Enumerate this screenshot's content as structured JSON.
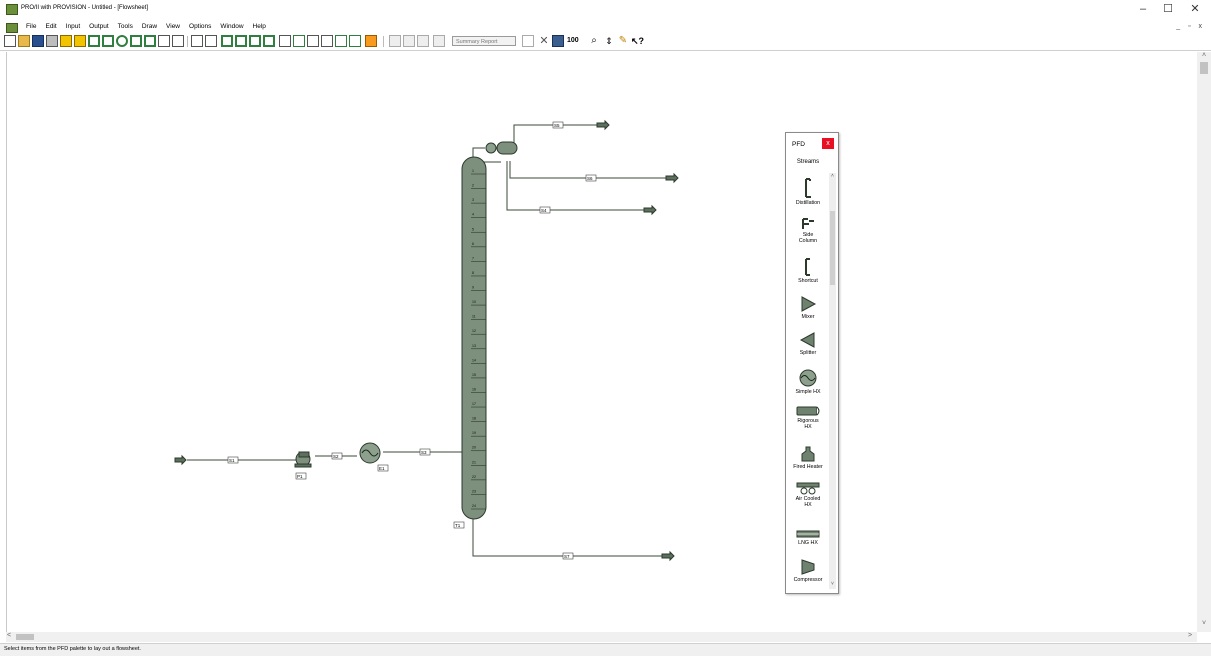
{
  "window": {
    "title": "PRO/II with PROVISION - Untitled - [Flowsheet]",
    "minimize": "–",
    "maximize": "☐",
    "close": "✕"
  },
  "menu": {
    "items": [
      "File",
      "Edit",
      "Input",
      "Output",
      "Tools",
      "Draw",
      "View",
      "Options",
      "Window",
      "Help"
    ],
    "mdi_controls": "_ ▫ x"
  },
  "toolbar": {
    "report_combo": "Summary Report",
    "zoom_label": "100"
  },
  "flowsheet": {
    "streams": [
      "S1",
      "S2",
      "S3",
      "S4",
      "S5",
      "S6",
      "S7"
    ],
    "units": [
      "P1",
      "E1",
      "T1"
    ],
    "trays": [
      "1",
      "2",
      "3",
      "4",
      "5",
      "6",
      "7",
      "8",
      "9",
      "10",
      "11",
      "12",
      "13",
      "14",
      "15",
      "16",
      "17",
      "18",
      "19",
      "20",
      "21",
      "22",
      "23",
      "24"
    ]
  },
  "palette": {
    "title": "PFD",
    "close": "x",
    "category": "Streams",
    "items": [
      "Distillation",
      "Side Column",
      "Shortcut",
      "Mixer",
      "Splitter",
      "Simple HX",
      "Rigorous HX",
      "Fired Heater",
      "Air Cooled HX",
      "LNG HX",
      "Compressor"
    ]
  },
  "statusbar": {
    "message": "Select items from the PFD palette to lay out a flowsheet."
  }
}
